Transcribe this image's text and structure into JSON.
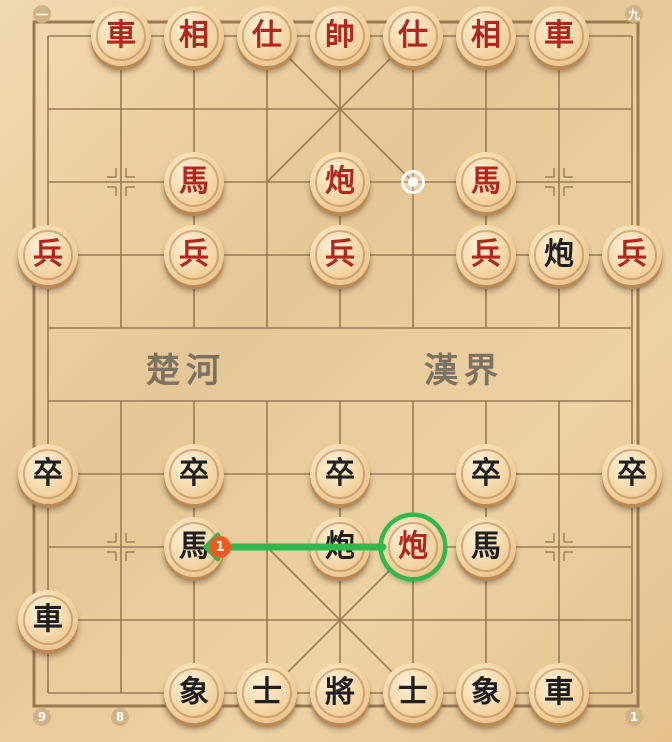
{
  "board": {
    "river_left": "楚河",
    "river_right": "漢界",
    "corner_top_left": "一",
    "corner_top_right": "九",
    "file_labels_bottom": [
      "9",
      "8",
      "1"
    ],
    "selected_square_hint": "white-dot-target"
  },
  "pieces": [
    {
      "glyph": "車",
      "side": "red",
      "file": 1,
      "rank": 0
    },
    {
      "glyph": "相",
      "side": "red",
      "file": 2,
      "rank": 0
    },
    {
      "glyph": "仕",
      "side": "red",
      "file": 3,
      "rank": 0
    },
    {
      "glyph": "帥",
      "side": "red",
      "file": 4,
      "rank": 0
    },
    {
      "glyph": "仕",
      "side": "red",
      "file": 5,
      "rank": 0
    },
    {
      "glyph": "相",
      "side": "red",
      "file": 6,
      "rank": 0
    },
    {
      "glyph": "車",
      "side": "red",
      "file": 7,
      "rank": 0
    },
    {
      "glyph": "馬",
      "side": "red",
      "file": 2,
      "rank": 2
    },
    {
      "glyph": "炮",
      "side": "red",
      "file": 4,
      "rank": 2
    },
    {
      "glyph": "馬",
      "side": "red",
      "file": 6,
      "rank": 2
    },
    {
      "glyph": "兵",
      "side": "red",
      "file": 0,
      "rank": 3
    },
    {
      "glyph": "兵",
      "side": "red",
      "file": 2,
      "rank": 3
    },
    {
      "glyph": "兵",
      "side": "red",
      "file": 4,
      "rank": 3
    },
    {
      "glyph": "兵",
      "side": "red",
      "file": 6,
      "rank": 3
    },
    {
      "glyph": "炮",
      "side": "black",
      "file": 7,
      "rank": 3
    },
    {
      "glyph": "兵",
      "side": "red",
      "file": 8,
      "rank": 3
    },
    {
      "glyph": "卒",
      "side": "black",
      "file": 0,
      "rank": 6
    },
    {
      "glyph": "卒",
      "side": "black",
      "file": 2,
      "rank": 6
    },
    {
      "glyph": "卒",
      "side": "black",
      "file": 4,
      "rank": 6
    },
    {
      "glyph": "卒",
      "side": "black",
      "file": 6,
      "rank": 6
    },
    {
      "glyph": "卒",
      "side": "black",
      "file": 8,
      "rank": 6
    },
    {
      "glyph": "馬",
      "side": "black",
      "file": 2,
      "rank": 7
    },
    {
      "glyph": "炮",
      "side": "black",
      "file": 4,
      "rank": 7
    },
    {
      "glyph": "炮",
      "side": "red",
      "file": 5,
      "rank": 7,
      "selected": true
    },
    {
      "glyph": "馬",
      "side": "black",
      "file": 6,
      "rank": 7
    },
    {
      "glyph": "車",
      "side": "black",
      "file": 0,
      "rank": 8
    },
    {
      "glyph": "象",
      "side": "black",
      "file": 2,
      "rank": 9
    },
    {
      "glyph": "士",
      "side": "black",
      "file": 3,
      "rank": 9
    },
    {
      "glyph": "將",
      "side": "black",
      "file": 4,
      "rank": 9
    },
    {
      "glyph": "士",
      "side": "black",
      "file": 5,
      "rank": 9
    },
    {
      "glyph": "象",
      "side": "black",
      "file": 6,
      "rank": 9
    },
    {
      "glyph": "車",
      "side": "black",
      "file": 7,
      "rank": 9
    }
  ],
  "move_arrow": {
    "label": "1",
    "from": {
      "file": 5,
      "rank": 7
    },
    "to": {
      "file": 2,
      "rank": 7
    },
    "color": "#2fb84c"
  },
  "hint_dot": {
    "file": 5,
    "rank": 2
  },
  "colors": {
    "red": "#b3261e",
    "black": "#1f1f1f",
    "line": "#9a7a55",
    "arrow": "#2fb84c",
    "badge": "#f05a22"
  }
}
